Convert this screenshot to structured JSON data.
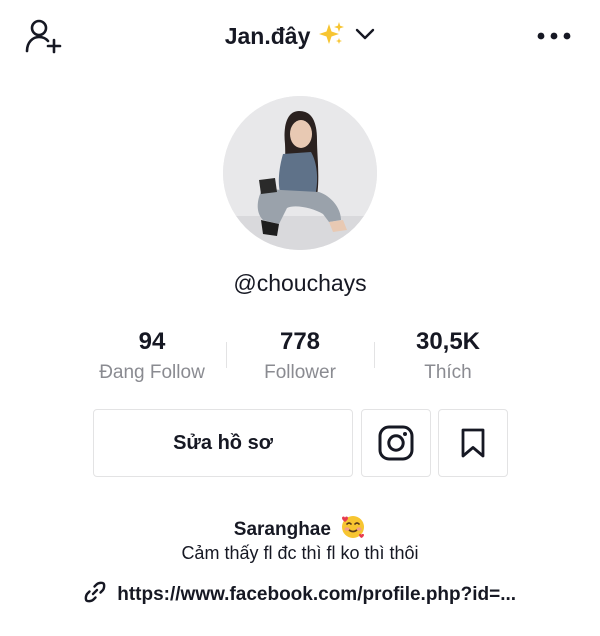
{
  "header": {
    "title": "Jan.đây",
    "add_user_icon": "add-user-icon",
    "more_icon": "more-icon",
    "dropdown_icon": "chevron-down-icon"
  },
  "profile": {
    "username": "@chouchays"
  },
  "stats": [
    {
      "value": "94",
      "label": "Đang Follow"
    },
    {
      "value": "778",
      "label": "Follower"
    },
    {
      "value": "30,5K",
      "label": "Thích"
    }
  ],
  "actions": {
    "edit_label": "Sửa hồ sơ",
    "instagram_icon": "instagram-icon",
    "bookmark_icon": "bookmark-icon"
  },
  "bio": {
    "name": "Saranghae",
    "emoji": "🥰",
    "text": "Cảm thấy fl đc thì fl ko thì thôi",
    "link": "https://www.facebook.com/profile.php?id=..."
  },
  "colors": {
    "text": "#161823",
    "secondary": "#8a8b91",
    "border": "#e3e3e4"
  }
}
